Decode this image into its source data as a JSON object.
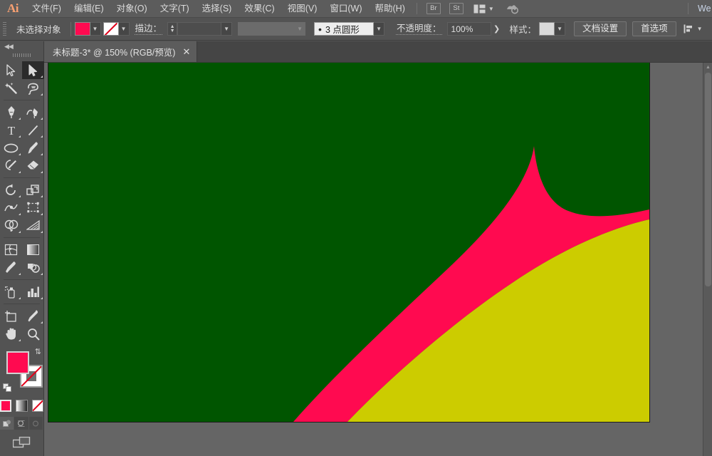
{
  "app": {
    "logo": "Ai",
    "accent_orange": "#f7a072",
    "chrome_bg": "#535353",
    "menubar_bg": "#5c5c5c"
  },
  "menubar": {
    "items": [
      {
        "label": "文件(F)",
        "name": "menu-file"
      },
      {
        "label": "编辑(E)",
        "name": "menu-edit"
      },
      {
        "label": "对象(O)",
        "name": "menu-object"
      },
      {
        "label": "文字(T)",
        "name": "menu-type"
      },
      {
        "label": "选择(S)",
        "name": "menu-select"
      },
      {
        "label": "效果(C)",
        "name": "menu-effect"
      },
      {
        "label": "视图(V)",
        "name": "menu-view"
      },
      {
        "label": "窗口(W)",
        "name": "menu-window"
      },
      {
        "label": "帮助(H)",
        "name": "menu-help"
      }
    ],
    "bridge_badge": "Br",
    "stock_badge": "St",
    "right_text": "We"
  },
  "controlbar": {
    "selection_status": "未选择对象",
    "fill_color": "#ff0a50",
    "stroke_value": "none",
    "stroke_label": "描边：",
    "stroke_weight": "",
    "stroke_profile": "",
    "brush_definition": "3 点圆形",
    "opacity_label": "不透明度：",
    "opacity_value": "100%",
    "style_label": "样式：",
    "style_swatch": "#d9d9d9",
    "document_setup_button": "文档设置",
    "preferences_button": "首选项"
  },
  "tabbar": {
    "document_tab": "未标题-3* @ 150% (RGB/预览)",
    "close_glyph": "✕"
  },
  "toolbar": {
    "collapse_glyph": "◀◀",
    "tools": [
      {
        "name": "tool-selection",
        "label": "选择工具",
        "active": false
      },
      {
        "name": "tool-direct-selection",
        "label": "直接选择工具",
        "active": true
      },
      {
        "name": "tool-magic-wand",
        "label": "魔棒工具",
        "active": false
      },
      {
        "name": "tool-lasso",
        "label": "套索工具",
        "active": false
      },
      {
        "name": "tool-pen",
        "label": "钢笔工具",
        "active": false
      },
      {
        "name": "tool-curvature",
        "label": "曲率工具",
        "active": false
      },
      {
        "name": "tool-type",
        "label": "文字工具",
        "active": false
      },
      {
        "name": "tool-line-segment",
        "label": "直线段工具",
        "active": false
      },
      {
        "name": "tool-ellipse",
        "label": "椭圆工具",
        "active": false
      },
      {
        "name": "tool-paintbrush",
        "label": "画笔工具",
        "active": false
      },
      {
        "name": "tool-shaper",
        "label": "Shaper 工具",
        "active": false
      },
      {
        "name": "tool-eraser",
        "label": "橡皮擦工具",
        "active": false
      },
      {
        "name": "tool-rotate",
        "label": "旋转工具",
        "active": false
      },
      {
        "name": "tool-scale",
        "label": "比例缩放工具",
        "active": false
      },
      {
        "name": "tool-width",
        "label": "宽度工具",
        "active": false
      },
      {
        "name": "tool-free-transform",
        "label": "自由变换工具",
        "active": false
      },
      {
        "name": "tool-shape-builder",
        "label": "形状生成器工具",
        "active": false
      },
      {
        "name": "tool-perspective-grid",
        "label": "透视网格工具",
        "active": false
      },
      {
        "name": "tool-mesh",
        "label": "网格工具",
        "active": false
      },
      {
        "name": "tool-gradient",
        "label": "渐变工具",
        "active": false
      },
      {
        "name": "tool-eyedropper",
        "label": "吸管工具",
        "active": false
      },
      {
        "name": "tool-blend",
        "label": "混合工具",
        "active": false
      },
      {
        "name": "tool-symbol-sprayer",
        "label": "符号喷枪工具",
        "active": false
      },
      {
        "name": "tool-column-graph",
        "label": "柱形图工具",
        "active": false
      },
      {
        "name": "tool-artboard",
        "label": "画板工具",
        "active": false
      },
      {
        "name": "tool-slice",
        "label": "切片工具",
        "active": false
      },
      {
        "name": "tool-hand",
        "label": "抓手工具",
        "active": false
      },
      {
        "name": "tool-zoom",
        "label": "缩放工具",
        "active": false
      }
    ],
    "fill_color": "#ff0a50",
    "stroke_color": "none",
    "color_mode_buttons": [
      "color",
      "gradient",
      "none"
    ],
    "draw_modes": [
      "正常绘图",
      "背面绘图",
      "内部绘图"
    ],
    "screen_mode": "更改屏幕模式"
  },
  "canvas": {
    "background": "#656565",
    "artboard_color": "#005500",
    "shapes": [
      {
        "name": "background-rect",
        "color": "#005500"
      },
      {
        "name": "pink-fin-shape",
        "color": "#ff0a50"
      },
      {
        "name": "yellow-triangle-shape",
        "color": "#cccc00"
      }
    ],
    "zoom_level": "150%"
  }
}
